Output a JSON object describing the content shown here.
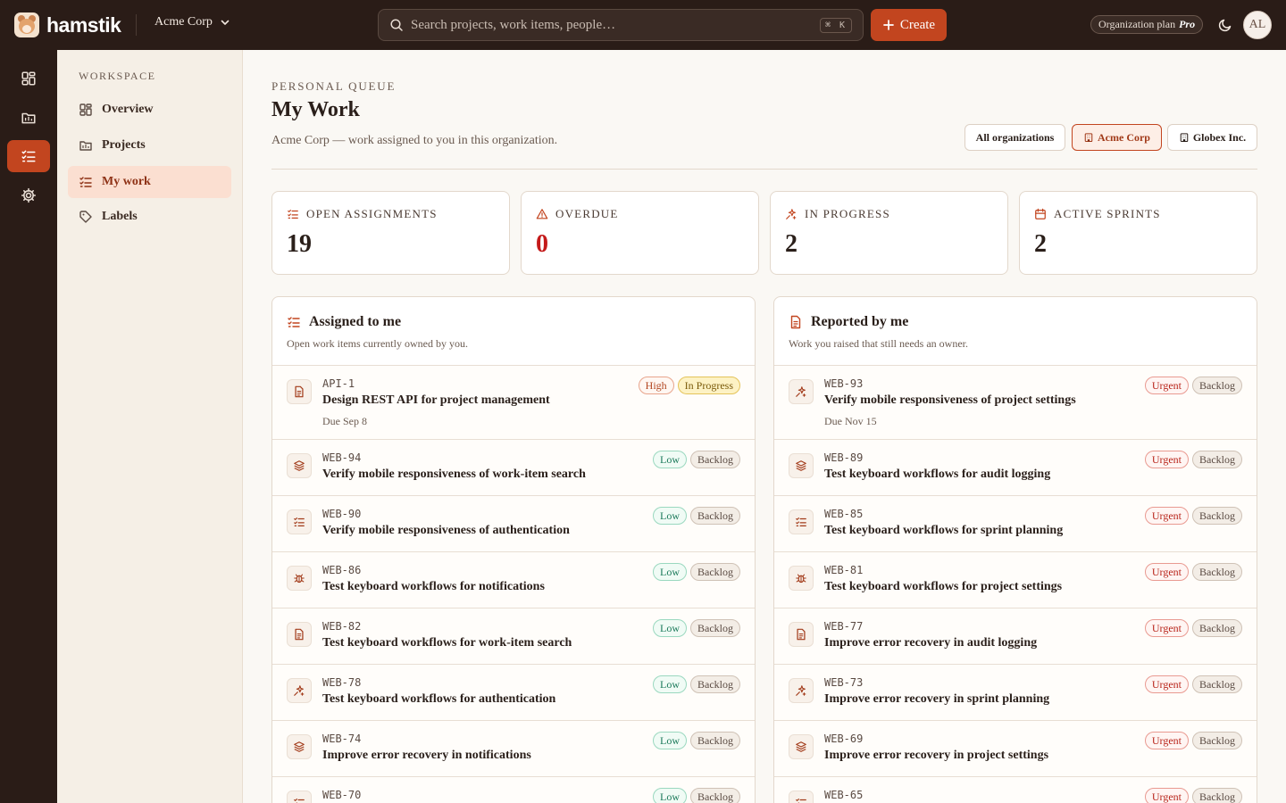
{
  "app": {
    "name": "hamstik"
  },
  "topbar": {
    "org_name": "Acme Corp",
    "search_placeholder": "Search projects, work items, people…",
    "shortcut": "⌘ K",
    "create_label": "Create",
    "plan_label": "Organization plan",
    "plan_name": "Pro",
    "avatar_initials": "AL"
  },
  "sidebar": {
    "heading": "WORKSPACE",
    "items": [
      {
        "label": "Overview",
        "icon": "overview-icon"
      },
      {
        "label": "Projects",
        "icon": "folder-icon"
      },
      {
        "label": "My work",
        "icon": "tasks-icon",
        "active": true
      },
      {
        "label": "Labels",
        "icon": "tag-icon"
      }
    ]
  },
  "page": {
    "eyebrow": "PERSONAL QUEUE",
    "title": "My Work",
    "subtitle": "Acme Corp — work assigned to you in this organization.",
    "org_filters": [
      "All organizations",
      "Acme Corp",
      "Globex Inc."
    ]
  },
  "stats": [
    {
      "label": "OPEN ASSIGNMENTS",
      "value": "19",
      "icon": "tasks-icon"
    },
    {
      "label": "OVERDUE",
      "value": "0",
      "icon": "warning-icon"
    },
    {
      "label": "IN PROGRESS",
      "value": "2",
      "icon": "sparkle-icon"
    },
    {
      "label": "ACTIVE SPRINTS",
      "value": "2",
      "icon": "calendar-icon"
    }
  ],
  "assigned": {
    "title": "Assigned to me",
    "subtitle": "Open work items currently owned by you.",
    "items": [
      {
        "key": "API-1",
        "title": "Design REST API for project management",
        "due": "Due Sep 8",
        "priority": "High",
        "status": "In Progress",
        "icon": "document-icon"
      },
      {
        "key": "WEB-94",
        "title": "Verify mobile responsiveness of work-item search",
        "priority": "Low",
        "status": "Backlog",
        "icon": "layers-icon"
      },
      {
        "key": "WEB-90",
        "title": "Verify mobile responsiveness of authentication",
        "priority": "Low",
        "status": "Backlog",
        "icon": "tasks-icon"
      },
      {
        "key": "WEB-86",
        "title": "Test keyboard workflows for notifications",
        "priority": "Low",
        "status": "Backlog",
        "icon": "bug-icon"
      },
      {
        "key": "WEB-82",
        "title": "Test keyboard workflows for work-item search",
        "priority": "Low",
        "status": "Backlog",
        "icon": "document-icon"
      },
      {
        "key": "WEB-78",
        "title": "Test keyboard workflows for authentication",
        "priority": "Low",
        "status": "Backlog",
        "icon": "sparkle-icon"
      },
      {
        "key": "WEB-74",
        "title": "Improve error recovery in notifications",
        "priority": "Low",
        "status": "Backlog",
        "icon": "layers-icon"
      },
      {
        "key": "WEB-70",
        "title": "",
        "priority": "Low",
        "status": "Backlog",
        "icon": "tasks-icon"
      }
    ]
  },
  "reported": {
    "title": "Reported by me",
    "subtitle": "Work you raised that still needs an owner.",
    "items": [
      {
        "key": "WEB-93",
        "title": "Verify mobile responsiveness of project settings",
        "due": "Due Nov 15",
        "priority": "Urgent",
        "status": "Backlog",
        "icon": "sparkle-icon"
      },
      {
        "key": "WEB-89",
        "title": "Test keyboard workflows for audit logging",
        "priority": "Urgent",
        "status": "Backlog",
        "icon": "layers-icon"
      },
      {
        "key": "WEB-85",
        "title": "Test keyboard workflows for sprint planning",
        "priority": "Urgent",
        "status": "Backlog",
        "icon": "tasks-icon"
      },
      {
        "key": "WEB-81",
        "title": "Test keyboard workflows for project settings",
        "priority": "Urgent",
        "status": "Backlog",
        "icon": "bug-icon"
      },
      {
        "key": "WEB-77",
        "title": "Improve error recovery in audit logging",
        "priority": "Urgent",
        "status": "Backlog",
        "icon": "document-icon"
      },
      {
        "key": "WEB-73",
        "title": "Improve error recovery in sprint planning",
        "priority": "Urgent",
        "status": "Backlog",
        "icon": "sparkle-icon"
      },
      {
        "key": "WEB-69",
        "title": "Improve error recovery in project settings",
        "priority": "Urgent",
        "status": "Backlog",
        "icon": "layers-icon"
      },
      {
        "key": "WEB-65",
        "title": "",
        "priority": "Urgent",
        "status": "Backlog",
        "icon": "tasks-icon"
      }
    ]
  },
  "colors": {
    "accent": "#c2451f",
    "topbar": "#2a1c17",
    "overdue": "#c41a1a"
  }
}
